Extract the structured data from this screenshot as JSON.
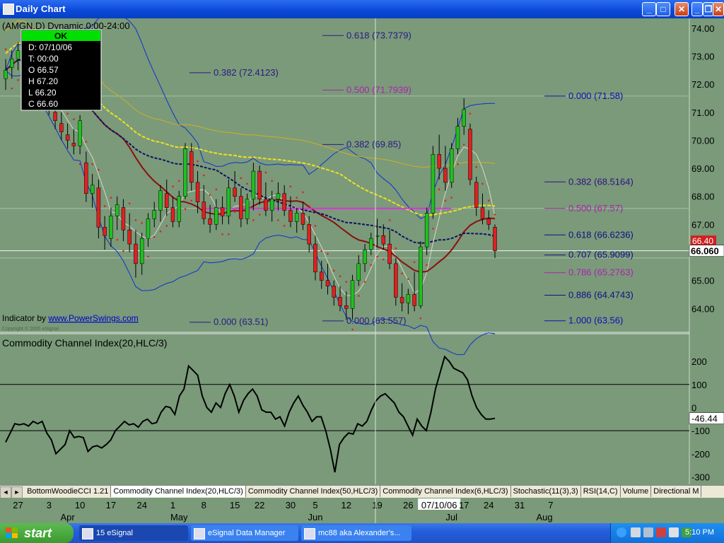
{
  "window": {
    "title": "Daily Chart",
    "buttons": {
      "min": "_",
      "restore": "□",
      "close": "✕",
      "inner_min": "_",
      "inner_restore": "❐",
      "inner_close": "✕"
    }
  },
  "chart_data": [
    {
      "type": "candlestick",
      "symbol_label": "(AMGN.D) Dynamic,0:00-24:00",
      "ylim": [
        63.2,
        74.3
      ],
      "ytick_labels": [
        "74.00",
        "73.00",
        "72.00",
        "71.00",
        "70.00",
        "69.00",
        "68.00",
        "67.00",
        "66.00",
        "65.00",
        "64.00"
      ],
      "ytick_values": [
        74,
        73,
        72,
        71,
        70,
        69,
        68,
        67,
        66,
        65,
        64
      ],
      "last_price_label": "66.060",
      "last_price": 66.06,
      "prev_price_label": "66.40",
      "prev_price": 66.4,
      "crosshair_date": "07/10/06",
      "data_window": {
        "header": "OK",
        "lines": [
          "D: 07/10/06",
          "T: 00:00",
          "O 66.57",
          "H 67.20",
          "L 66.20",
          "C 66.60"
        ]
      },
      "credit_prefix": "Indicator by ",
      "credit_link": "www.PowerSwings.com",
      "copyright": "Copyright © 2005 eSignal",
      "fib_sets": [
        {
          "color": "#2a1a80",
          "levels": [
            {
              "label": "0.000 (63.51)",
              "value": 63.51
            },
            {
              "label": "0.382 (72.4123)",
              "value": 72.4123
            }
          ]
        },
        {
          "color": "#2a1a80",
          "levels": [
            {
              "label": "0.000 (63.557)",
              "value": 63.557
            },
            {
              "label": "0.382 (69.85)",
              "value": 69.85
            },
            {
              "label": "0.500 (71.7939)",
              "value": 71.7939,
              "color": "#b020b0"
            },
            {
              "label": "0.618 (73.7379)",
              "value": 73.7379
            }
          ]
        },
        {
          "color": "#1a1a90",
          "levels": [
            {
              "label": "0.000 (71.58)",
              "value": 71.58,
              "color": "#1010b0"
            },
            {
              "label": "0.382 (68.5164)",
              "value": 68.5164,
              "color": "#301080"
            },
            {
              "label": "0.500 (67.57)",
              "value": 67.57,
              "color": "#b020b0"
            },
            {
              "label": "0.618 (66.6236)",
              "value": 66.6236,
              "color": "#101080"
            },
            {
              "label": "0.707 (65.9099)",
              "value": 65.9099,
              "color": "#101080"
            },
            {
              "label": "0.786 (65.2763)",
              "value": 65.2763,
              "color": "#b020b0"
            },
            {
              "label": "0.886 (64.4743)",
              "value": 64.4743,
              "color": "#101080"
            },
            {
              "label": "1.000 (63.56)",
              "value": 63.56,
              "color": "#1010b0"
            }
          ]
        }
      ],
      "hlines": [
        71.58,
        67.57,
        66.06,
        65.8
      ],
      "candles": [
        {
          "o": 72.2,
          "h": 72.9,
          "l": 71.8,
          "c": 72.5
        },
        {
          "o": 72.6,
          "h": 73.2,
          "l": 72.2,
          "c": 72.9
        },
        {
          "o": 72.9,
          "h": 73.5,
          "l": 72.5,
          "c": 73.2
        },
        {
          "o": 73.0,
          "h": 73.4,
          "l": 72.6,
          "c": 72.8
        },
        {
          "o": 72.7,
          "h": 73.0,
          "l": 71.9,
          "c": 72.1
        },
        {
          "o": 72.0,
          "h": 72.3,
          "l": 71.5,
          "c": 71.8
        },
        {
          "o": 71.7,
          "h": 72.0,
          "l": 71.2,
          "c": 71.5
        },
        {
          "o": 71.4,
          "h": 71.8,
          "l": 70.9,
          "c": 71.1
        },
        {
          "o": 71.0,
          "h": 71.4,
          "l": 70.4,
          "c": 70.7
        },
        {
          "o": 70.6,
          "h": 71.0,
          "l": 70.0,
          "c": 70.3
        },
        {
          "o": 70.2,
          "h": 70.6,
          "l": 69.7,
          "c": 70.0
        },
        {
          "o": 69.9,
          "h": 70.4,
          "l": 69.5,
          "c": 69.8
        },
        {
          "o": 69.8,
          "h": 70.9,
          "l": 69.5,
          "c": 70.7
        },
        {
          "o": 69.2,
          "h": 69.6,
          "l": 67.8,
          "c": 68.1
        },
        {
          "o": 68.1,
          "h": 68.8,
          "l": 67.6,
          "c": 68.4
        },
        {
          "o": 68.3,
          "h": 68.6,
          "l": 66.5,
          "c": 66.9
        },
        {
          "o": 66.9,
          "h": 67.3,
          "l": 66.1,
          "c": 66.6
        },
        {
          "o": 66.5,
          "h": 67.6,
          "l": 66.2,
          "c": 67.3
        },
        {
          "o": 67.3,
          "h": 68.0,
          "l": 66.8,
          "c": 67.7
        },
        {
          "o": 67.6,
          "h": 67.9,
          "l": 66.4,
          "c": 66.8
        },
        {
          "o": 66.8,
          "h": 67.4,
          "l": 66.0,
          "c": 66.3
        },
        {
          "o": 66.3,
          "h": 66.8,
          "l": 65.1,
          "c": 65.6
        },
        {
          "o": 65.6,
          "h": 66.7,
          "l": 65.2,
          "c": 66.5
        },
        {
          "o": 66.5,
          "h": 67.4,
          "l": 66.2,
          "c": 67.2
        },
        {
          "o": 67.2,
          "h": 67.8,
          "l": 66.9,
          "c": 67.5
        },
        {
          "o": 67.5,
          "h": 68.4,
          "l": 67.1,
          "c": 68.2
        },
        {
          "o": 68.1,
          "h": 68.6,
          "l": 67.3,
          "c": 67.6
        },
        {
          "o": 67.6,
          "h": 68.0,
          "l": 66.9,
          "c": 67.1
        },
        {
          "o": 67.1,
          "h": 68.2,
          "l": 66.9,
          "c": 68.0
        },
        {
          "o": 68.0,
          "h": 69.9,
          "l": 67.9,
          "c": 69.7
        },
        {
          "o": 69.6,
          "h": 69.9,
          "l": 68.2,
          "c": 68.5
        },
        {
          "o": 68.5,
          "h": 68.9,
          "l": 67.4,
          "c": 67.8
        },
        {
          "o": 67.8,
          "h": 68.4,
          "l": 67.0,
          "c": 67.2
        },
        {
          "o": 67.2,
          "h": 67.7,
          "l": 66.7,
          "c": 67.0
        },
        {
          "o": 67.0,
          "h": 67.9,
          "l": 66.8,
          "c": 67.6
        },
        {
          "o": 67.6,
          "h": 68.0,
          "l": 67.0,
          "c": 67.3
        },
        {
          "o": 67.3,
          "h": 68.6,
          "l": 67.0,
          "c": 68.3
        },
        {
          "o": 68.3,
          "h": 68.9,
          "l": 67.8,
          "c": 68.0
        },
        {
          "o": 68.0,
          "h": 68.3,
          "l": 66.9,
          "c": 67.2
        },
        {
          "o": 67.2,
          "h": 68.1,
          "l": 67.0,
          "c": 67.9
        },
        {
          "o": 67.9,
          "h": 69.2,
          "l": 67.5,
          "c": 68.9
        },
        {
          "o": 68.9,
          "h": 69.1,
          "l": 67.7,
          "c": 67.9
        },
        {
          "o": 67.9,
          "h": 68.5,
          "l": 67.3,
          "c": 67.5
        },
        {
          "o": 67.5,
          "h": 68.2,
          "l": 67.1,
          "c": 67.9
        },
        {
          "o": 67.9,
          "h": 68.5,
          "l": 67.5,
          "c": 68.1
        },
        {
          "o": 68.1,
          "h": 68.4,
          "l": 67.3,
          "c": 67.5
        },
        {
          "o": 67.5,
          "h": 68.0,
          "l": 66.9,
          "c": 67.1
        },
        {
          "o": 67.1,
          "h": 67.6,
          "l": 66.7,
          "c": 67.4
        },
        {
          "o": 67.4,
          "h": 67.8,
          "l": 66.8,
          "c": 67.0
        },
        {
          "o": 67.0,
          "h": 67.3,
          "l": 66.0,
          "c": 66.3
        },
        {
          "o": 66.3,
          "h": 66.6,
          "l": 65.0,
          "c": 65.3
        },
        {
          "o": 65.3,
          "h": 65.7,
          "l": 64.7,
          "c": 65.0
        },
        {
          "o": 65.0,
          "h": 65.6,
          "l": 64.5,
          "c": 64.8
        },
        {
          "o": 64.8,
          "h": 65.0,
          "l": 64.1,
          "c": 64.4
        },
        {
          "o": 64.4,
          "h": 64.8,
          "l": 63.9,
          "c": 64.1
        },
        {
          "o": 64.1,
          "h": 64.6,
          "l": 63.6,
          "c": 64.0
        },
        {
          "o": 64.0,
          "h": 65.2,
          "l": 63.6,
          "c": 65.0
        },
        {
          "o": 65.0,
          "h": 65.9,
          "l": 64.8,
          "c": 65.6
        },
        {
          "o": 65.6,
          "h": 66.3,
          "l": 65.3,
          "c": 66.1
        },
        {
          "o": 66.1,
          "h": 66.7,
          "l": 65.9,
          "c": 66.5
        },
        {
          "o": 66.57,
          "h": 67.2,
          "l": 66.2,
          "c": 66.6
        },
        {
          "o": 66.6,
          "h": 67.0,
          "l": 66.1,
          "c": 66.3
        },
        {
          "o": 66.3,
          "h": 66.8,
          "l": 65.4,
          "c": 65.6
        },
        {
          "o": 65.6,
          "h": 65.8,
          "l": 64.1,
          "c": 64.4
        },
        {
          "o": 64.4,
          "h": 64.9,
          "l": 63.9,
          "c": 64.2
        },
        {
          "o": 64.2,
          "h": 64.7,
          "l": 63.8,
          "c": 64.5
        },
        {
          "o": 64.5,
          "h": 65.3,
          "l": 63.9,
          "c": 64.1
        },
        {
          "o": 64.1,
          "h": 66.4,
          "l": 64.0,
          "c": 66.2
        },
        {
          "o": 66.2,
          "h": 67.6,
          "l": 65.9,
          "c": 67.4
        },
        {
          "o": 67.4,
          "h": 69.8,
          "l": 67.2,
          "c": 69.5
        },
        {
          "o": 69.5,
          "h": 70.2,
          "l": 68.6,
          "c": 69.0
        },
        {
          "o": 69.0,
          "h": 69.8,
          "l": 68.2,
          "c": 68.5
        },
        {
          "o": 68.5,
          "h": 69.9,
          "l": 68.3,
          "c": 69.7
        },
        {
          "o": 69.7,
          "h": 70.8,
          "l": 69.5,
          "c": 70.5
        },
        {
          "o": 70.5,
          "h": 71.5,
          "l": 70.2,
          "c": 71.1
        },
        {
          "o": 70.4,
          "h": 70.6,
          "l": 68.4,
          "c": 68.6
        },
        {
          "o": 68.5,
          "h": 68.7,
          "l": 67.3,
          "c": 67.6
        },
        {
          "o": 67.6,
          "h": 68.1,
          "l": 67.0,
          "c": 67.2
        },
        {
          "o": 67.2,
          "h": 67.5,
          "l": 66.8,
          "c": 67.0
        },
        {
          "o": 66.9,
          "h": 67.0,
          "l": 65.8,
          "c": 66.06
        }
      ],
      "x_axis_labels": [
        {
          "label": "27",
          "i": 2
        },
        {
          "label": "3",
          "i": 7
        },
        {
          "label": "10",
          "i": 12
        },
        {
          "label": "17",
          "i": 17
        },
        {
          "label": "24",
          "i": 22
        },
        {
          "label": "1",
          "i": 27
        },
        {
          "label": "8",
          "i": 32
        },
        {
          "label": "15",
          "i": 37
        },
        {
          "label": "22",
          "i": 41
        },
        {
          "label": "30",
          "i": 46
        },
        {
          "label": "5",
          "i": 50
        },
        {
          "label": "12",
          "i": 55
        },
        {
          "label": "19",
          "i": 60
        },
        {
          "label": "26",
          "i": 65
        },
        {
          "label": "07/10/06",
          "i": 70
        },
        {
          "label": "17",
          "i": 74
        },
        {
          "label": "24",
          "i": 78
        },
        {
          "label": "31",
          "i": 83
        },
        {
          "label": "7",
          "i": 88
        }
      ],
      "month_labels": [
        {
          "label": "Apr",
          "i": 10
        },
        {
          "label": "May",
          "i": 28
        },
        {
          "label": "Jun",
          "i": 50
        },
        {
          "label": "Jul",
          "i": 72
        },
        {
          "label": "Aug",
          "i": 87
        }
      ]
    },
    {
      "type": "line",
      "title": "Commodity Channel Index(20,HLC/3)",
      "ylim": [
        -320,
        240
      ],
      "ytick_labels": [
        "200",
        "100",
        "0",
        "-100",
        "-200",
        "-300"
      ],
      "ytick_values": [
        200,
        100,
        0,
        -100,
        -200,
        -300
      ],
      "hlines": [
        100,
        -100
      ],
      "last_value_label": "-46.44",
      "last_value": -46.44,
      "values": [
        -150,
        -110,
        -70,
        -75,
        -70,
        -80,
        -60,
        -70,
        -60,
        -110,
        -140,
        -200,
        -180,
        -160,
        -100,
        -130,
        -125,
        -130,
        -190,
        -170,
        -165,
        -175,
        -160,
        -140,
        -100,
        -80,
        -60,
        -75,
        -70,
        -85,
        -60,
        -50,
        -70,
        -65,
        -20,
        5,
        0,
        -30,
        50,
        80,
        180,
        160,
        140,
        50,
        0,
        -20,
        20,
        0,
        60,
        100,
        50,
        -20,
        30,
        60,
        80,
        50,
        -10,
        -20,
        -20,
        -50,
        -40,
        -80,
        -20,
        20,
        50,
        10,
        -20,
        -60,
        -40,
        -40,
        -100,
        -180,
        -280,
        -160,
        -130,
        -110,
        -115,
        -70,
        -80,
        -60,
        -10,
        30,
        50,
        60,
        40,
        20,
        -20,
        -40,
        -80,
        -120,
        -50,
        -80,
        -100,
        -20,
        80,
        150,
        220,
        200,
        170,
        160,
        150,
        120,
        50,
        0,
        -30,
        -50,
        -50,
        -46.44
      ]
    }
  ],
  "tabs": [
    "BottomWoodieCCI 1.21",
    "Commodity Channel Index(20,HLC/3)",
    "Commodity Channel Index(50,HLC/3)",
    "Commodity Channel Index(6,HLC/3)",
    "Stochastic(11(3),3)",
    "RSI(14,C)",
    "Volume",
    "Directional M"
  ],
  "tabs_nav": {
    "left": "◄",
    "right": "►"
  },
  "taskbar": {
    "start_label": "start",
    "tasks": [
      "15 eSignal",
      "eSignal Data Manager",
      "mc88 aka Alexander's..."
    ],
    "clock": "5:10 PM"
  }
}
